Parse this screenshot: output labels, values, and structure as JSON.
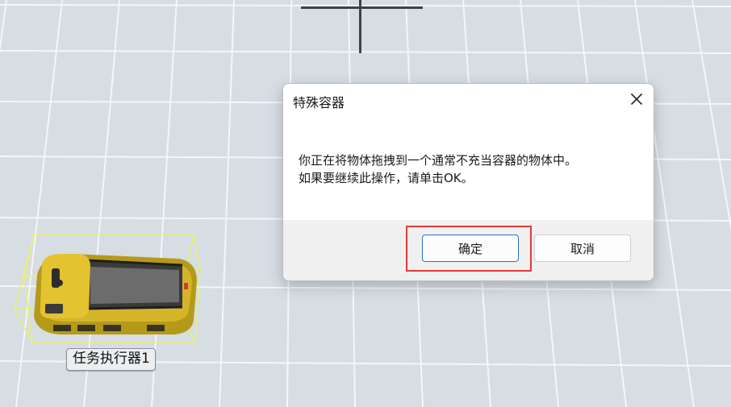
{
  "dialog": {
    "title": "特殊容器",
    "close_icon": "close-icon",
    "message_line1": "你正在将物体拖拽到一个通常不充当容器的物体中。",
    "message_line2": "如果要继续此操作，请单击OK。",
    "ok_label": "确定",
    "cancel_label": "取消"
  },
  "scene": {
    "object_label": "任务执行器1",
    "object_icon": "task-executor-agv",
    "background_color": "#d6dde3",
    "grid_color": "#f4f6f8"
  },
  "annotation": {
    "highlight_color": "#e0393c",
    "highlight_target": "ok-button"
  }
}
